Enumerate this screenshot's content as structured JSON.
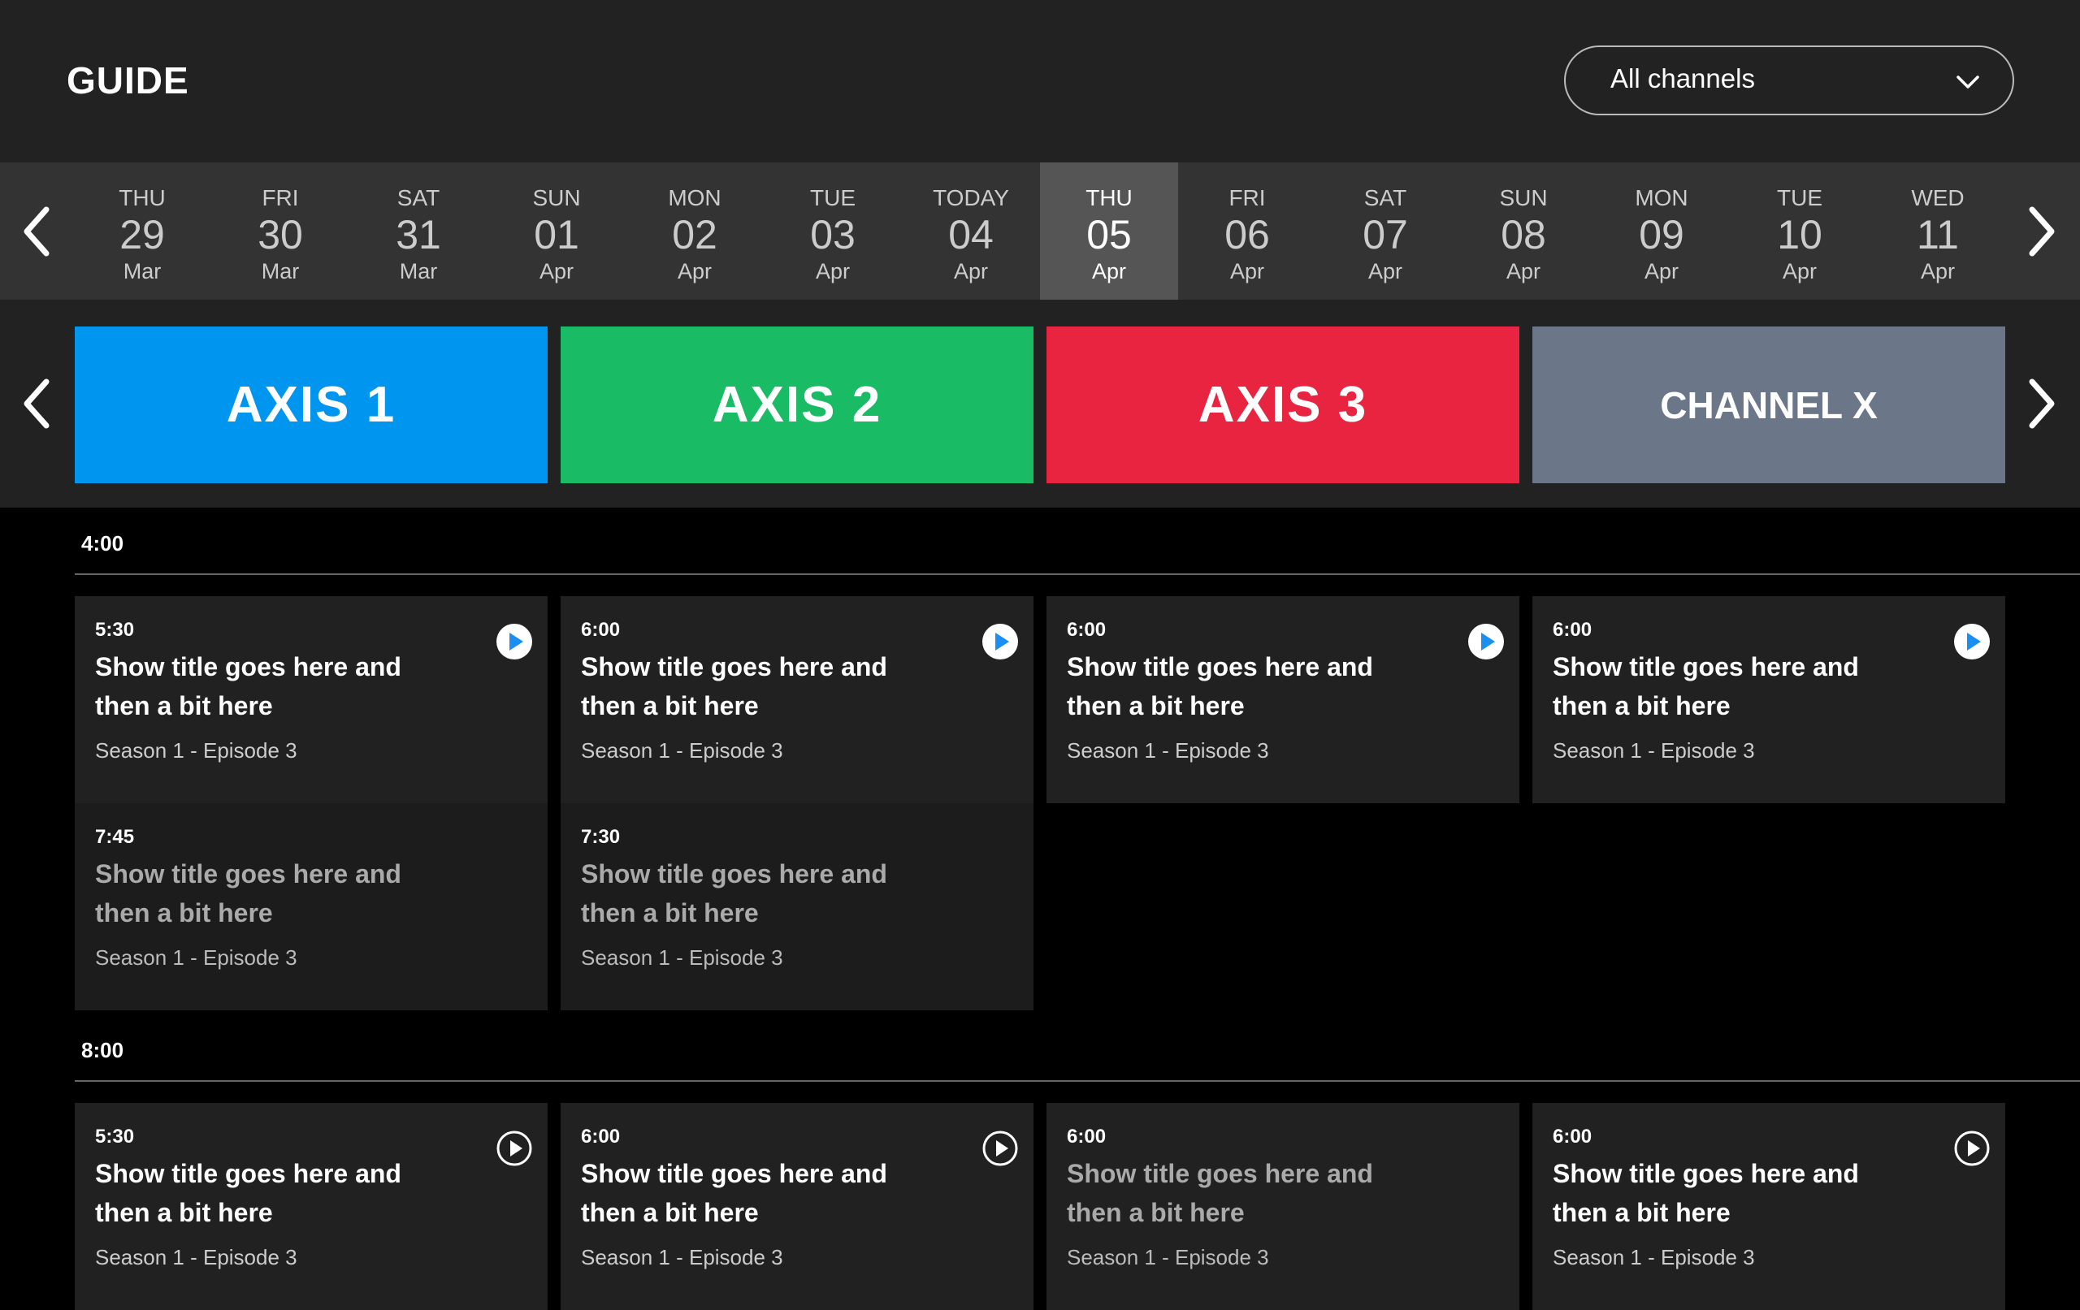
{
  "header": {
    "title": "GUIDE",
    "channel_filter": "All channels"
  },
  "dates": [
    {
      "dow": "THU",
      "day": "29",
      "month": "Mar"
    },
    {
      "dow": "FRI",
      "day": "30",
      "month": "Mar"
    },
    {
      "dow": "SAT",
      "day": "31",
      "month": "Mar"
    },
    {
      "dow": "SUN",
      "day": "01",
      "month": "Apr"
    },
    {
      "dow": "MON",
      "day": "02",
      "month": "Apr"
    },
    {
      "dow": "TUE",
      "day": "03",
      "month": "Apr"
    },
    {
      "dow": "TODAY",
      "day": "04",
      "month": "Apr"
    },
    {
      "dow": "THU",
      "day": "05",
      "month": "Apr"
    },
    {
      "dow": "FRI",
      "day": "06",
      "month": "Apr"
    },
    {
      "dow": "SAT",
      "day": "07",
      "month": "Apr"
    },
    {
      "dow": "SUN",
      "day": "08",
      "month": "Apr"
    },
    {
      "dow": "MON",
      "day": "09",
      "month": "Apr"
    },
    {
      "dow": "TUE",
      "day": "10",
      "month": "Apr"
    },
    {
      "dow": "WED",
      "day": "11",
      "month": "Apr"
    }
  ],
  "selected_date": "THU 05 Apr",
  "channels": [
    {
      "name": "AXIS 1",
      "color": "#0096f0"
    },
    {
      "name": "AXIS 2",
      "color": "#19bb64"
    },
    {
      "name": "AXIS 3",
      "color": "#e82440"
    },
    {
      "name": "CHANNEL X",
      "color": "#6b7788"
    }
  ],
  "time_slots": [
    {
      "time": "4:00"
    },
    {
      "time": "8:00"
    }
  ],
  "programs": [
    {
      "time": "5:30",
      "title": "Show title goes here and then a bit here",
      "subtitle": "Season 1 - Episode 3"
    },
    {
      "time": "6:00",
      "title": "Show title goes here and then a bit here",
      "subtitle": "Season 1 - Episode 3"
    },
    {
      "time": "6:00",
      "title": "Show title goes here and then a bit here",
      "subtitle": "Season 1 - Episode 3"
    },
    {
      "time": "6:00",
      "title": "Show title goes here and then a bit here",
      "subtitle": "Season 1 - Episode 3"
    },
    {
      "time": "7:45",
      "title": "Show title goes here and then a bit here",
      "subtitle": "Season 1 - Episode 3"
    },
    {
      "time": "7:30",
      "title": "Show title goes here and then a bit here",
      "subtitle": "Season 1 - Episode 3"
    },
    {
      "time": "5:30",
      "title": "Show title goes here and then a bit here",
      "subtitle": "Season 1 - Episode 3"
    },
    {
      "time": "6:00",
      "title": "Show title goes here and then a bit here",
      "subtitle": "Season 1 - Episode 3"
    },
    {
      "time": "6:00",
      "title": "Show title goes here and then a bit here",
      "subtitle": "Season 1 - Episode 3"
    },
    {
      "time": "6:00",
      "title": "Show title goes here and then a bit here",
      "subtitle": "Season 1 - Episode 3"
    }
  ],
  "icons": {
    "play_filled": "play-circle-filled-icon",
    "play_outline": "play-circle-outline-icon",
    "chevron_left": "chevron-left-icon",
    "chevron_right": "chevron-right-icon",
    "chevron_down": "chevron-down-icon"
  },
  "colors": {
    "play_accent": "#1a8ff2",
    "background": "#000000",
    "panel": "#222222",
    "card": "#212121",
    "selected_date": "#555555"
  }
}
